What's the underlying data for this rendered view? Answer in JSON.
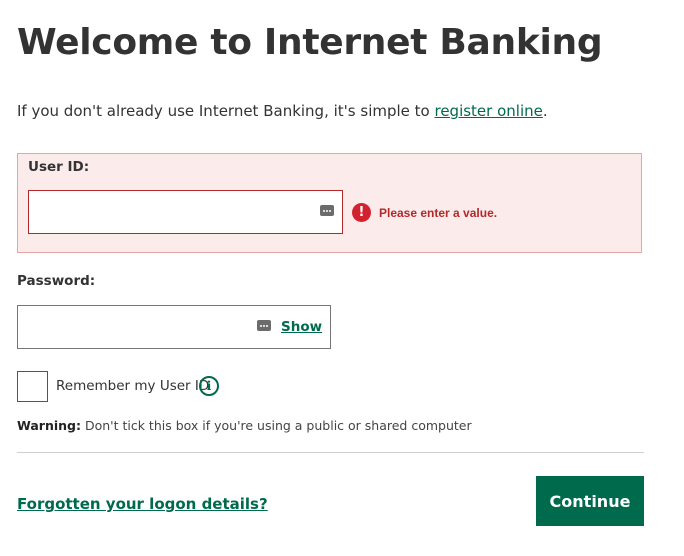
{
  "page": {
    "title": "Welcome to Internet Banking",
    "intro_prefix": "If you don't already use Internet Banking, it's simple to ",
    "intro_link": "register online",
    "intro_suffix": "."
  },
  "form": {
    "user_id": {
      "label": "User ID:",
      "value": "",
      "error": "Please enter a value."
    },
    "password": {
      "label": "Password:",
      "value": "",
      "show_label": "Show"
    },
    "remember": {
      "label": "Remember my User ID",
      "checked": false
    },
    "warning_bold": "Warning:",
    "warning_text": " Don't tick this box if you're using a public or shared computer"
  },
  "footer": {
    "forgot_link": "Forgotten your logon details?",
    "continue_label": "Continue"
  },
  "icons": {
    "error": "error-icon",
    "info": "info-icon",
    "password_manager": "password-manager-icon"
  },
  "colors": {
    "brand_green": "#006a4d",
    "error_red": "#b5282a",
    "error_background": "#fbeceb"
  }
}
